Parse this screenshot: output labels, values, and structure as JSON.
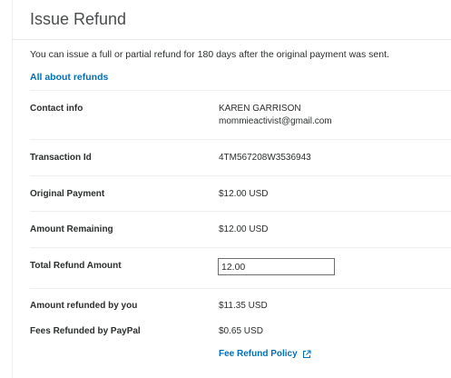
{
  "header": {
    "title": "Issue Refund"
  },
  "intro": {
    "text": "You can issue a full or partial refund for 180 days after the original payment was sent.",
    "link_label": "All about refunds"
  },
  "details": {
    "contact_label": "Contact info",
    "contact_name": "KAREN GARRISON",
    "contact_email": "mommieactivist@gmail.com",
    "transaction_label": "Transaction Id",
    "transaction_id": "4TM567208W3536943",
    "original_label": "Original Payment",
    "original_value": "$12.00 USD",
    "remaining_label": "Amount Remaining",
    "remaining_value": "$12.00 USD",
    "total_label": "Total Refund Amount",
    "total_value": "12.00",
    "refunded_label": "Amount refunded by you",
    "refunded_value": "$11.35 USD",
    "fees_label": "Fees Refunded by PayPal",
    "fees_value": "$0.65 USD",
    "policy_link": "Fee Refund Policy",
    "policy_icon": "external-link-icon"
  },
  "colors": {
    "link": "#0070ba",
    "text": "#2c2e2f",
    "divider": "#eceeef"
  }
}
